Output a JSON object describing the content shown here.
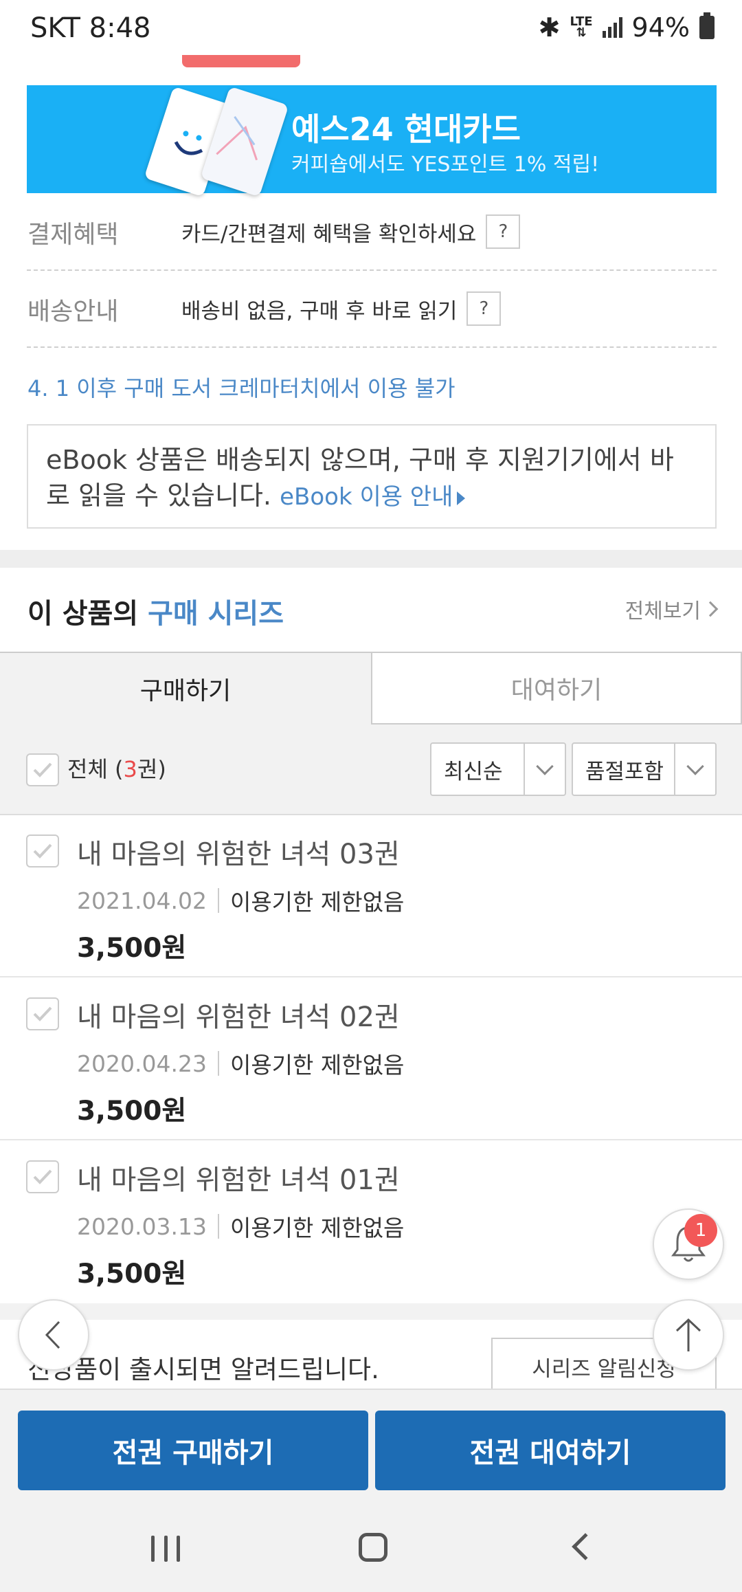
{
  "status_bar": {
    "carrier_time": "SKT 8:48",
    "network": "LTE",
    "battery": "94%"
  },
  "banner": {
    "title": "예스24 현대카드",
    "subtitle": "커피숍에서도 YES포인트 1% 적립!",
    "color": "#1ab0f5"
  },
  "info": {
    "payment_label": "결제혜택",
    "payment_text": "카드/간편결제 혜택을 확인하세요",
    "delivery_label": "배송안내",
    "delivery_text": "배송비 없음, 구매 후 바로 읽기",
    "help": "?",
    "notice": "4. 1 이후 구매 도서 크레마터치에서 이용 불가"
  },
  "ebook_notice": {
    "text": "eBook 상품은 배송되지 않으며, 구매 후 지원기기에서 바로 읽을 수 있습니다.",
    "link": "eBook 이용 안내"
  },
  "series": {
    "title_prefix": "이 상품의",
    "title_accent": "구매 시리즈",
    "view_all": "전체보기",
    "tabs": {
      "buy": "구매하기",
      "rent": "대여하기"
    },
    "select_all_prefix": "전체 (",
    "select_all_count": "3",
    "select_all_suffix": "권)",
    "sort_option": "최신순",
    "stock_option": "품절포함",
    "items": [
      {
        "title": "내 마음의 위험한 녀석 03권",
        "date": "2021.04.02",
        "limit": "이용기한 제한없음",
        "price": "3,500원"
      },
      {
        "title": "내 마음의 위험한 녀석 02권",
        "date": "2020.04.23",
        "limit": "이용기한 제한없음",
        "price": "3,500원"
      },
      {
        "title": "내 마음의 위험한 녀석 01권",
        "date": "2020.03.13",
        "limit": "이용기한 제한없음",
        "price": "3,500원"
      }
    ],
    "alert_text": "신상품이 출시되면 알려드립니다.",
    "alert_button": "시리즈 알림신청"
  },
  "actions": {
    "buy_all": "전권 구매하기",
    "rent_all": "전권 대여하기",
    "button_color": "#1d6cb4"
  },
  "floating": {
    "notification_count": "1"
  }
}
